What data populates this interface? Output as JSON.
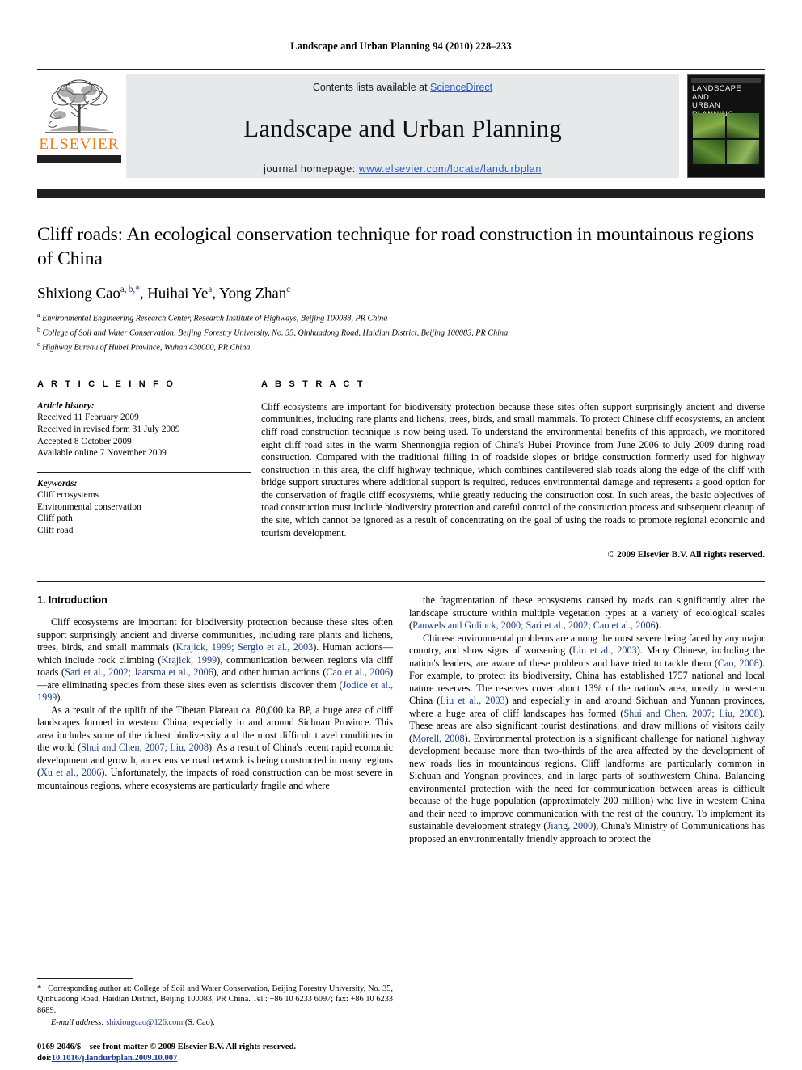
{
  "running_head": "Landscape and Urban Planning 94 (2010) 228–233",
  "banner": {
    "contents_prefix": "Contents lists available at ",
    "sciencedirect": "ScienceDirect",
    "journal_name": "Landscape and Urban Planning",
    "homepage_prefix": "journal homepage: ",
    "homepage_url": "www.elsevier.com/locate/landurbplan",
    "publisher_wordmark": "ELSEVIER",
    "cover_title_line1": "LANDSCAPE AND",
    "cover_title_line2": "URBAN PLANNING",
    "link_color": "#2f5bb7",
    "wordmark_color": "#ef7d17"
  },
  "article": {
    "title": "Cliff roads: An ecological conservation technique for road construction in mountainous regions of China",
    "authors_html": "Shixiong Cao<sup>a, b,</sup><sup>*</sup>, Huihai Ye<sup>a</sup>, Yong Zhan<sup>c</sup>",
    "affiliations": [
      "Environmental Engineering Research Center, Research Institute of Highways, Beijing 100088, PR China",
      "College of Soil and Water Conservation, Beijing Forestry University, No. 35, Qinhuadong Road, Haidian District, Beijing 100083, PR China",
      "Highway Bureau of Hubei Province, Wuhan 430000, PR China"
    ],
    "affiliation_marks": [
      "a",
      "b",
      "c"
    ]
  },
  "article_info": {
    "heading": "A R T I C L E   I N F O",
    "history_label": "Article history:",
    "history": [
      "Received 11 February 2009",
      "Received in revised form 31 July 2009",
      "Accepted 8 October 2009",
      "Available online 7 November 2009"
    ],
    "keywords_label": "Keywords:",
    "keywords": [
      "Cliff ecosystems",
      "Environmental conservation",
      "Cliff path",
      "Cliff road"
    ]
  },
  "abstract": {
    "heading": "A B S T R A C T",
    "text": "Cliff ecosystems are important for biodiversity protection because these sites often support surprisingly ancient and diverse communities, including rare plants and lichens, trees, birds, and small mammals. To protect Chinese cliff ecosystems, an ancient cliff road construction technique is now being used. To understand the environmental benefits of this approach, we monitored eight cliff road sites in the warm Shennongjia region of China's Hubei Province from June 2006 to July 2009 during road construction. Compared with the traditional filling in of roadside slopes or bridge construction formerly used for highway construction in this area, the cliff highway technique, which combines cantilevered slab roads along the edge of the cliff with bridge support structures where additional support is required, reduces environmental damage and represents a good option for the conservation of fragile cliff ecosystems, while greatly reducing the construction cost. In such areas, the basic objectives of road construction must include biodiversity protection and careful control of the construction process and subsequent cleanup of the site, which cannot be ignored as a result of concentrating on the goal of using the roads to promote regional economic and tourism development.",
    "copyright": "© 2009 Elsevier B.V. All rights reserved."
  },
  "introduction": {
    "heading": "1.  Introduction",
    "left_paragraphs_html": [
      "Cliff ecosystems are important for biodiversity protection because these sites often support surprisingly ancient and diverse communities, including rare plants and lichens, trees, birds, and small mammals (<span class=\"cite\">Krajick, 1999; Sergio et al., 2003</span>). Human actions—which include rock climbing (<span class=\"cite\">Krajick, 1999</span>), communication between regions via cliff roads (<span class=\"cite\">Sari et al., 2002; Jaarsma et al., 2006</span>), and other human actions (<span class=\"cite\">Cao et al., 2006</span>)—are eliminating species from these sites even as scientists discover them (<span class=\"cite\">Jodice et al., 1999</span>).",
      "As a result of the uplift of the Tibetan Plateau ca. 80,000 ka BP, a huge area of cliff landscapes formed in western China, especially in and around Sichuan Province. This area includes some of the richest biodiversity and the most difficult travel conditions in the world (<span class=\"cite\">Shui and Chen, 2007; Liu, 2008</span>). As a result of China's recent rapid economic development and growth, an extensive road network is being constructed in many regions (<span class=\"cite\">Xu et al., 2006</span>). Unfortunately, the impacts of road construction can be most severe in mountainous regions, where ecosystems are particularly fragile and where"
    ],
    "right_paragraphs_html": [
      "the fragmentation of these ecosystems caused by roads can significantly alter the landscape structure within multiple vegetation types at a variety of ecological scales (<span class=\"cite\">Pauwels and Gulinck, 2000; Sari et al., 2002; Cao et al., 2006</span>).",
      "Chinese environmental problems are among the most severe being faced by any major country, and show signs of worsening (<span class=\"cite\">Liu et al., 2003</span>). Many Chinese, including the nation's leaders, are aware of these problems and have tried to tackle them (<span class=\"cite\">Cao, 2008</span>). For example, to protect its biodiversity, China has established 1757 national and local nature reserves. The reserves cover about 13% of the nation's area, mostly in western China (<span class=\"cite\">Liu et al., 2003</span>) and especially in and around Sichuan and Yunnan provinces, where a huge area of cliff landscapes has formed (<span class=\"cite\">Shui and Chen, 2007; Liu, 2008</span>). These areas are also significant tourist destinations, and draw millions of visitors daily (<span class=\"cite\">Morell, 2008</span>). Environmental protection is a significant challenge for national highway development because more than two-thirds of the area affected by the development of new roads lies in mountainous regions. Cliff landforms are particularly common in Sichuan and Yongnan provinces, and in large parts of southwestern China. Balancing environmental protection with the need for communication between areas is difficult because of the huge population (approximately 200 million) who live in western China and their need to improve communication with the rest of the country. To implement its sustainable development strategy (<span class=\"cite\">Jiang, 2000</span>), China's Ministry of Communications has proposed an environmentally friendly approach to protect the"
    ]
  },
  "footnote": {
    "corresponding_html": "<span class=\"star\">*</span>&ensp; Corresponding author at: College of Soil and Water Conservation, Beijing Forestry University, No. 35, Qinhuadong Road, Haidian District, Beijing 100083, PR China. Tel.: +86 10 6233 6097; fax: +86 10 6233 8689.",
    "email_html": "<span class=\"email-lbl\">E-mail address:</span> <span class=\"email\">shixiongcao@126.com</span> (S. Cao)."
  },
  "imprint": {
    "line1": "0169-2046/$ – see front matter © 2009 Elsevier B.V. All rights reserved.",
    "doi_label": "doi:",
    "doi_value": "10.1016/j.landurbplan.2009.10.007"
  }
}
